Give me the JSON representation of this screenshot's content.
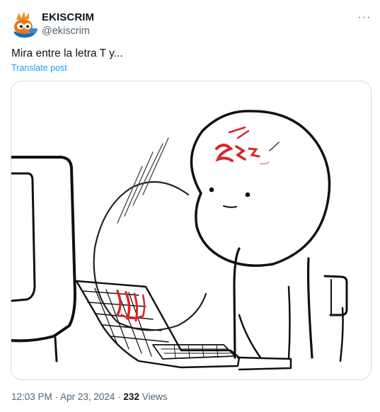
{
  "author": {
    "display_name": "EKISCRIM",
    "handle": "@ekiscrim",
    "avatar_icon": "cartoon-avatar-icon"
  },
  "more_icon": "more-horizontal-icon",
  "more_label": "···",
  "post": {
    "text": "Mira entre la letra T y...",
    "translate_label": "Translate post"
  },
  "media": {
    "description_icon": "meme-image-head-on-keyboard"
  },
  "meta": {
    "time": "12:03 PM",
    "separator": "·",
    "date": "Apr 23, 2024",
    "views_count": "232",
    "views_label": "Views"
  },
  "colors": {
    "accent": "#1d9bf0",
    "secondary_text": "#536471",
    "primary_text": "#0f1419",
    "border": "#cfd9de",
    "blood_red": "#d9262b"
  }
}
